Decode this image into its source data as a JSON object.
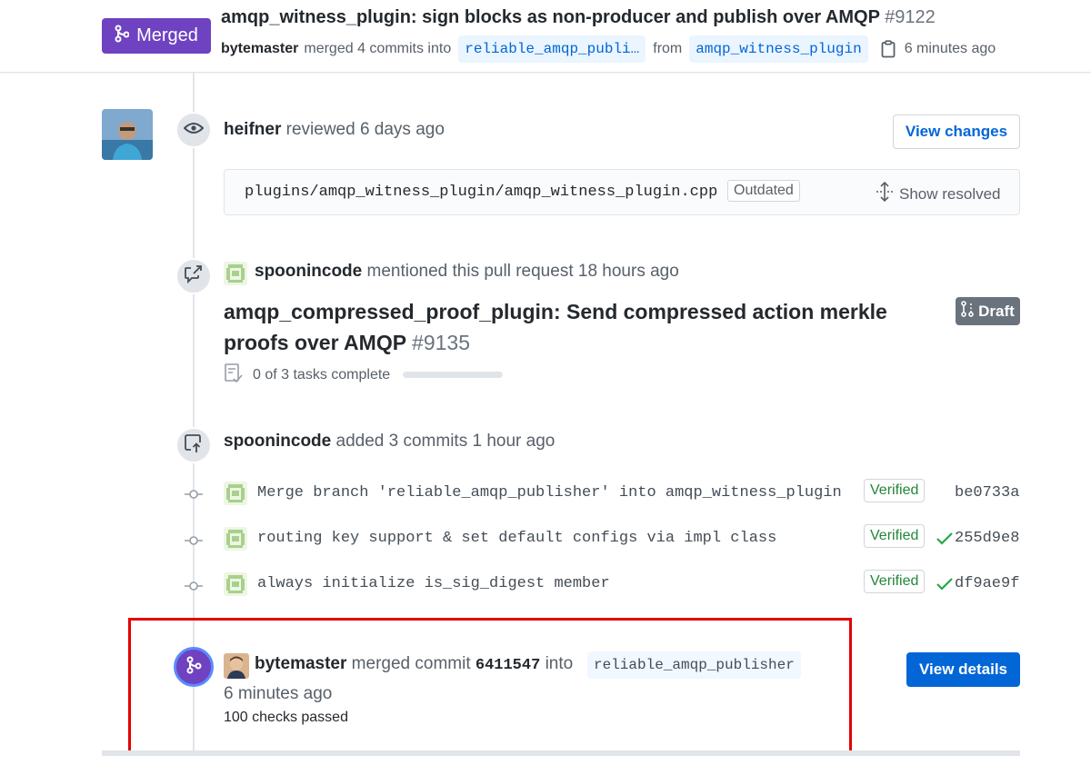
{
  "header": {
    "state_label": "Merged",
    "title": "amqp_witness_plugin: sign blocks as non-producer and publish over AMQP",
    "number": "#9122",
    "author": "bytemaster",
    "merged_text": "merged 4 commits into",
    "base_branch": "reliable_amqp_publi…",
    "from_text": "from",
    "head_branch": "amqp_witness_plugin",
    "time": "6 minutes ago"
  },
  "review": {
    "user": "heifner",
    "action": "reviewed 6 days ago",
    "view_changes_label": "View changes",
    "file_path": "plugins/amqp_witness_plugin/amqp_witness_plugin.cpp",
    "outdated_label": "Outdated",
    "show_resolved_label": "Show resolved"
  },
  "mention": {
    "user": "spoonincode",
    "action": "mentioned this pull request 18 hours ago",
    "linked_title": "amqp_compressed_proof_plugin: Send compressed action merkle proofs over AMQP",
    "linked_number": "#9135",
    "draft_label": "Draft",
    "tasks_text": "0 of 3 tasks complete",
    "tasks_progress": 0
  },
  "commits_event": {
    "user": "spoonincode",
    "action": "added 3 commits 1 hour ago",
    "commits": [
      {
        "message": "Merge branch 'reliable_amqp_publisher' into amqp_witness_plugin",
        "verified": "Verified",
        "check": false,
        "sha": "be0733a"
      },
      {
        "message": "routing key support & set default configs via impl class",
        "verified": "Verified",
        "check": true,
        "sha": "255d9e8"
      },
      {
        "message": "always initialize is_sig_digest member",
        "verified": "Verified",
        "check": true,
        "sha": "df9ae9f"
      }
    ]
  },
  "merge_event": {
    "user": "bytemaster",
    "action": "merged commit",
    "commit": "6411547",
    "into_text": "into",
    "branch": "reliable_amqp_publisher",
    "time": "6 minutes ago",
    "checks": "100 checks passed",
    "view_details_label": "View details"
  },
  "colors": {
    "merged_purple": "#6f42c1",
    "primary_blue": "#0366d6",
    "verified_green": "#22863a",
    "highlight_red": "#e30000"
  },
  "icons": [
    "git-merge-icon",
    "clipboard-icon",
    "eye-icon",
    "cross-reference-icon",
    "unfold-icon",
    "git-pull-request-draft-icon",
    "tasklist-icon",
    "repo-push-icon",
    "git-commit-icon",
    "check-icon"
  ]
}
